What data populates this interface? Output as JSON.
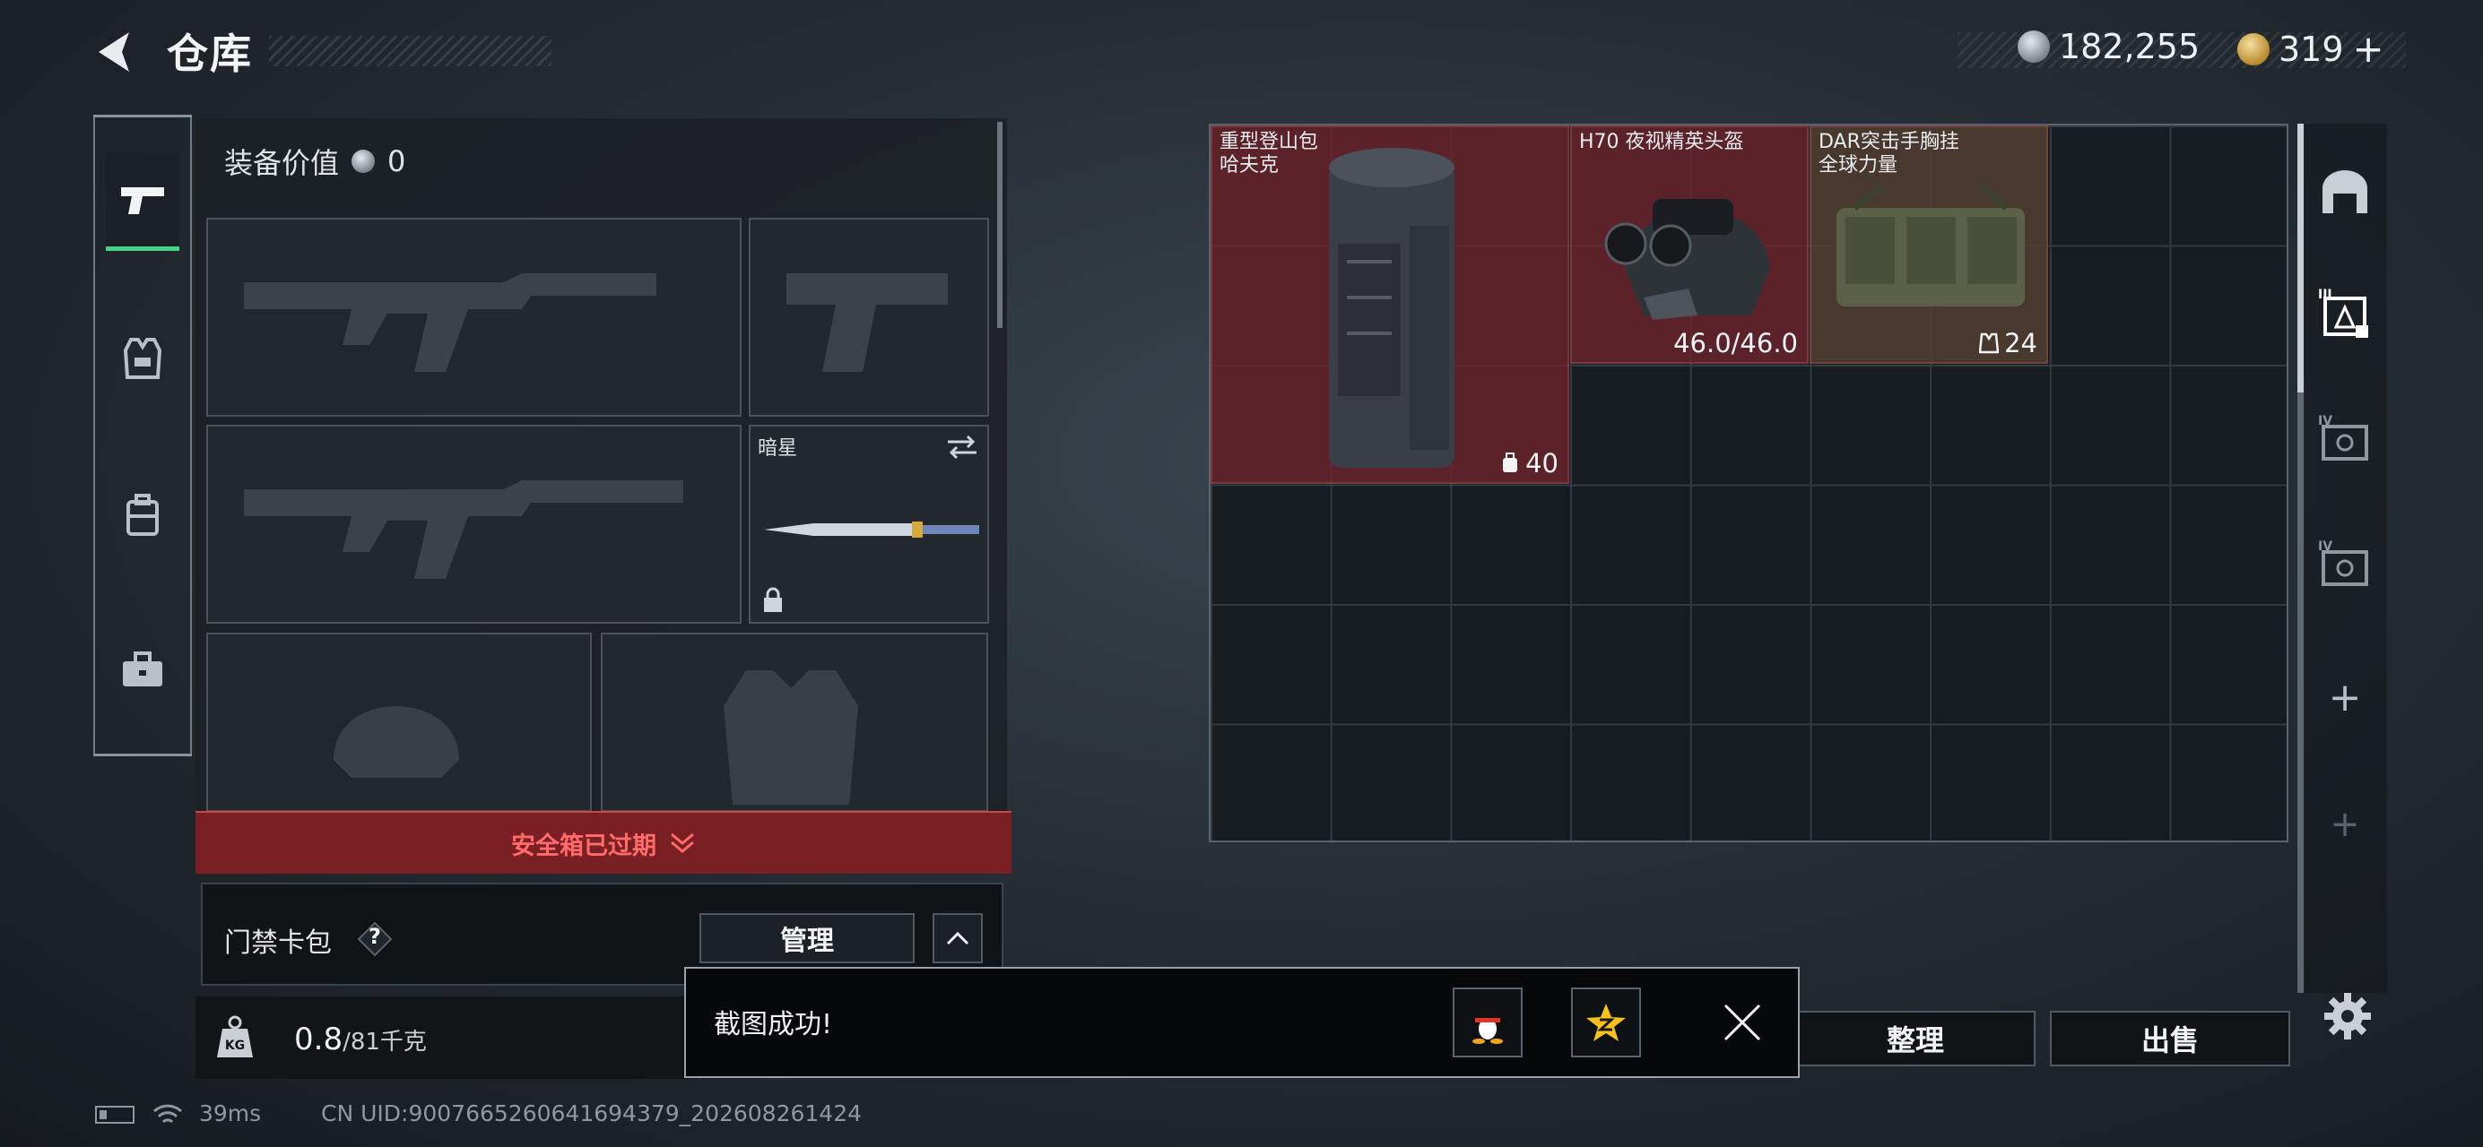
{
  "header": {
    "title": "仓库",
    "currency": {
      "silver_value": "182,255",
      "gold_value": "319",
      "gold_add": "+"
    }
  },
  "left_tabs": [
    {
      "name": "weapons",
      "icon": "pistol-icon",
      "active": true
    },
    {
      "name": "armor",
      "icon": "armor-vest-icon",
      "active": false
    },
    {
      "name": "backpack",
      "icon": "backpack-icon",
      "active": false
    },
    {
      "name": "toolbox",
      "icon": "toolbox-icon",
      "active": false
    }
  ],
  "equipment": {
    "value_label": "装备价值",
    "value": "0",
    "melee_slot_label": "暗星"
  },
  "alert": {
    "text": "安全箱已过期"
  },
  "keycard": {
    "label": "门禁卡包",
    "help": "?",
    "manage_label": "管理"
  },
  "weight": {
    "current": "0.8",
    "capacity": "/81千克"
  },
  "stash": {
    "items": [
      {
        "name": "重型登山包\n哈夫克",
        "stat": "40",
        "stat_icon": "backpack-capacity-icon",
        "color": "red"
      },
      {
        "name": "H70 夜视精英头盔",
        "stat": "46.0/46.0",
        "stat_icon": "",
        "color": "red"
      },
      {
        "name": "DAR突击手胸挂\n全球力量",
        "stat": "24",
        "stat_icon": "vest-capacity-icon",
        "color": "brown"
      }
    ],
    "sort_label": "整理",
    "sell_label": "出售"
  },
  "right_tabs": [
    {
      "icon": "storage-room-icon",
      "label": ""
    },
    {
      "icon": "container-iii-icon",
      "label": "III"
    },
    {
      "icon": "container-iv-icon",
      "label": "IV"
    },
    {
      "icon": "container-iv-icon",
      "label": "IV"
    },
    {
      "icon": "plus-icon",
      "label": "+"
    },
    {
      "icon": "plus-icon",
      "label": "+"
    }
  ],
  "toast": {
    "text": "截图成功!"
  },
  "status_bar": {
    "ping": "39ms",
    "uid": "CN UID:9007665260641694379_202608261424"
  },
  "colors": {
    "accent_green": "#47d28c",
    "alert_red": "#7a1f24",
    "alert_text": "#ff6b6b",
    "item_red": "#6e242c"
  }
}
